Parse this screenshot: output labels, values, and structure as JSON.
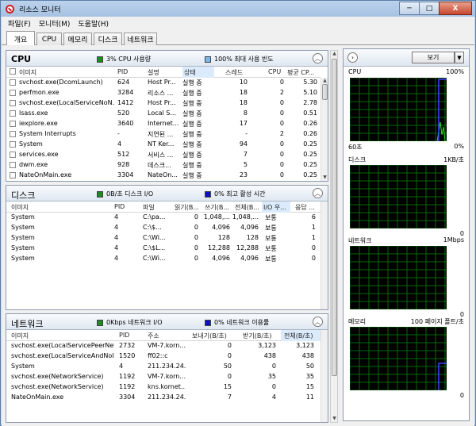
{
  "window": {
    "title": "리소스 모니터",
    "min": "─",
    "max": "□",
    "close": "X"
  },
  "menu": [
    "파일(F)",
    "모니터(M)",
    "도움말(H)"
  ],
  "tabs": [
    "개요",
    "CPU",
    "메모리",
    "디스크",
    "네트워크"
  ],
  "colors": {
    "green": "#1f8a1f",
    "blue": "#1010c8",
    "lightblue": "#7ab6e8",
    "graph_bg": "#000000",
    "grid": "#006a00"
  },
  "cpu": {
    "title": "CPU",
    "ind1_text": "3% CPU 사용량",
    "ind2_text": "100% 최대 사용 빈도",
    "columns": [
      "이미지",
      "PID",
      "설명",
      "상태",
      "스레드",
      "CPU",
      "평균 CP..."
    ],
    "rows": [
      [
        "svchost.exe(DcomLaunch)",
        "624",
        "Host Pr...",
        "실행 중",
        "10",
        "0",
        "5.30"
      ],
      [
        "perfmon.exe",
        "3284",
        "리소스 ...",
        "실행 중",
        "18",
        "2",
        "5.10"
      ],
      [
        "svchost.exe(LocalServiceNoN...",
        "1412",
        "Host Pr...",
        "실행 중",
        "18",
        "0",
        "2.78"
      ],
      [
        "lsass.exe",
        "520",
        "Local S...",
        "실행 중",
        "8",
        "0",
        "0.51"
      ],
      [
        "iexplore.exe",
        "3640",
        "Internet...",
        "실행 중",
        "17",
        "0",
        "0.26"
      ],
      [
        "System Interrupts",
        "-",
        "지연된 ...",
        "실행 중",
        "-",
        "2",
        "0.26"
      ],
      [
        "System",
        "4",
        "NT Ker...",
        "실행 중",
        "94",
        "0",
        "0.25"
      ],
      [
        "services.exe",
        "512",
        "서비스 ...",
        "실행 중",
        "7",
        "0",
        "0.25"
      ],
      [
        "dwm.exe",
        "928",
        "데스크...",
        "실행 중",
        "5",
        "0",
        "0.25"
      ],
      [
        "NateOnMain.exe",
        "3304",
        "NateOn...",
        "실행 중",
        "23",
        "0",
        "0.25"
      ]
    ]
  },
  "disk": {
    "title": "디스크",
    "ind1_text": "0B/초 디스크 I/O",
    "ind2_text": "0% 최고 활성 시간",
    "columns": [
      "이미지",
      "PID",
      "파일",
      "읽기(B...",
      "쓰기(B...",
      "전체(B...",
      "I/O 우...",
      "응답 ..."
    ],
    "rows": [
      [
        "System",
        "4",
        "C:\\pa...",
        "0",
        "1,048,...",
        "1,048,...",
        "보통",
        "6"
      ],
      [
        "System",
        "4",
        "C:\\$...",
        "0",
        "4,096",
        "4,096",
        "보통",
        "1"
      ],
      [
        "System",
        "4",
        "C:\\Wi...",
        "0",
        "128",
        "128",
        "보통",
        "1"
      ],
      [
        "System",
        "4",
        "C:\\$L...",
        "0",
        "12,288",
        "12,288",
        "보통",
        "0"
      ],
      [
        "System",
        "4",
        "C:\\Wi...",
        "0",
        "4,096",
        "4,096",
        "보통",
        "0"
      ]
    ]
  },
  "network": {
    "title": "네트워크",
    "ind1_text": "0Kbps 네트워크 I/O",
    "ind2_text": "0% 네트워크 이용률",
    "columns": [
      "이미지",
      "PID",
      "주소",
      "보내기(B/초)",
      "받기(B/초)",
      "전체(B/초)"
    ],
    "rows": [
      [
        "svchost.exe(LocalServicePeerNet)",
        "2732",
        "VM-7.korn...",
        "0",
        "3,123",
        "3,123"
      ],
      [
        "svchost.exe(LocalServiceAndNoI...",
        "1520",
        "ff02::c",
        "0",
        "438",
        "438"
      ],
      [
        "System",
        "4",
        "211.234.24...",
        "50",
        "0",
        "50"
      ],
      [
        "svchost.exe(NetworkService)",
        "1192",
        "VM-7.korn...",
        "0",
        "35",
        "35"
      ],
      [
        "svchost.exe(NetworkService)",
        "1192",
        "kns.kornet...",
        "15",
        "0",
        "15"
      ],
      [
        "NateOnMain.exe",
        "3304",
        "211.234.24...",
        "7",
        "4",
        "11"
      ]
    ]
  },
  "right_panel": {
    "nav_icon": "chevron-right-icon",
    "view_label": "보기",
    "graphs": [
      {
        "name": "CPU",
        "max": "100%",
        "bottom_left": "60초",
        "bottom_right": "0%",
        "green_level": 0.3,
        "blue_level": 1.0
      },
      {
        "name": "디스크",
        "max": "1KB/초",
        "bottom_left": "",
        "bottom_right": "0",
        "green_level": 0,
        "blue_level": 0
      },
      {
        "name": "네트워크",
        "max": "1Mbps",
        "bottom_left": "",
        "bottom_right": "0",
        "green_level": 0,
        "blue_level": 0
      },
      {
        "name": "메모리",
        "max": "100 페이지 폴트/초",
        "bottom_left": "",
        "bottom_right": "0",
        "green_level": 0,
        "blue_level": 0.45
      }
    ]
  }
}
